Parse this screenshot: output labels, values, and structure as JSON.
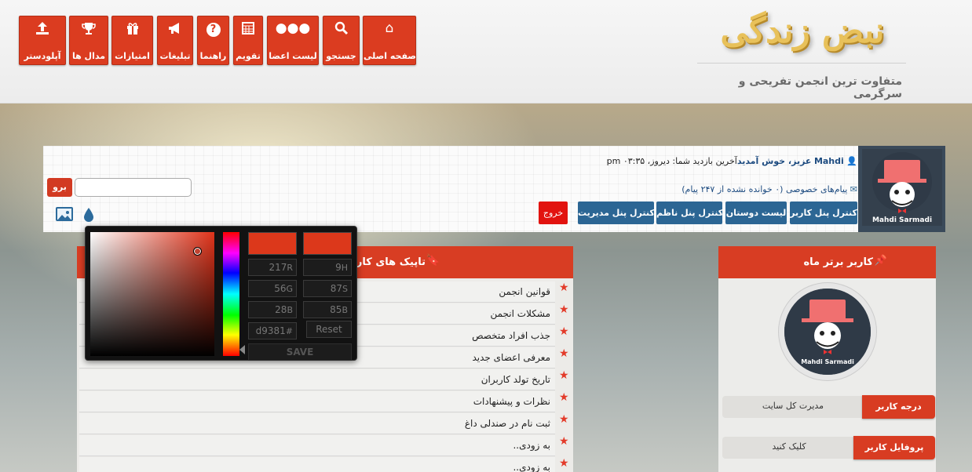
{
  "header": {
    "logo": "نبض زندگی",
    "tagline": "متفاوت ترین انجمن تفریحی و سرگرمی"
  },
  "nav": [
    {
      "label": "صفحه اصلی",
      "icon": "home-icon"
    },
    {
      "label": "جستجو",
      "icon": "search-icon"
    },
    {
      "label": "لیست اعضا",
      "icon": "users-icon"
    },
    {
      "label": "تقویم",
      "icon": "calendar-icon"
    },
    {
      "label": "راهنما",
      "icon": "help-icon"
    },
    {
      "label": "تبلیغات",
      "icon": "megaphone-icon"
    },
    {
      "label": "امتیازات",
      "icon": "gift-icon"
    },
    {
      "label": "مدال ها",
      "icon": "trophy-icon"
    },
    {
      "label": "آپلودستر",
      "icon": "upload-icon"
    }
  ],
  "user": {
    "name": "Mahdi",
    "welcome": "عزیز، خوش آمدید",
    "last_visit": "آخرین بازدید شما: دیروز، ۰۳:۳۵ pm",
    "pm_text": "پیام‌های خصوصی (۰ خوانده نشده از ۲۴۷ پیام)",
    "avatar_name": "Mahdi Sarmadi",
    "buttons": {
      "user_cp": "کنترل پنل کاربر",
      "friends": "لیست دوستان",
      "mod_cp": "کنترل پنل ناظم",
      "admin_cp": "کنترل پنل مدیریت",
      "logout": "خروج"
    }
  },
  "search": {
    "go_label": "برو",
    "value": ""
  },
  "topics": {
    "title": "تاپیک های کاربر",
    "items": [
      "قوانین انجمن",
      "مشکلات انجمن",
      "جذب افراد متخصص",
      "معرفی اعضای جدید",
      "تاریخ تولد کاربران",
      "نظرات و پیشنهادات",
      "ثبت نام در صندلی داغ",
      "به زودی..",
      "به زودی.."
    ]
  },
  "sidebar": {
    "title": "کاربر برتر ماه",
    "avatar_name": "Mahdi Sarmadi",
    "rank_label": "درجه کاربر",
    "rank_value": "مدیرت کل سایت",
    "profile_label": "پروفایل کاربر",
    "profile_value": "کلیک کنید"
  },
  "colorpicker": {
    "color": "#dc381b",
    "hsb": {
      "h": "9",
      "s": "87",
      "b": "85"
    },
    "rgb": {
      "r": "217",
      "g": "56",
      "b": "28"
    },
    "hex": "d9381",
    "hex_prefix": "#",
    "reset_label": "Reset",
    "save_label": "SAVE"
  }
}
